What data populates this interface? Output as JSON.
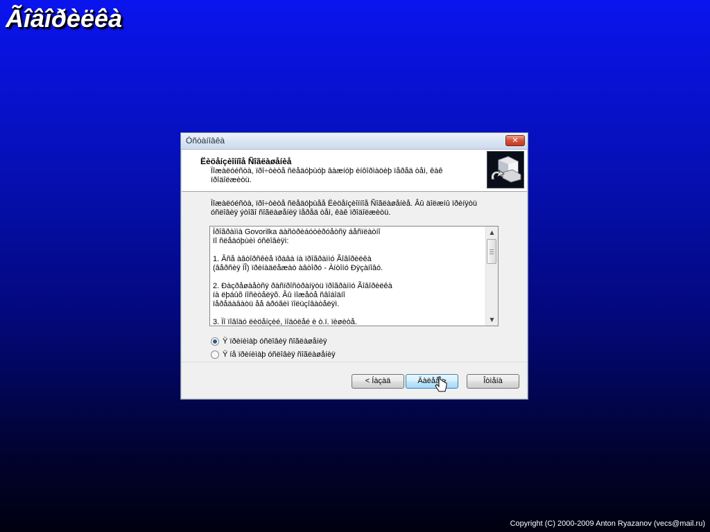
{
  "app": {
    "title": "Ãîâîðèëêà",
    "copyright": "Copyright (C) 2000-2009 Anton Ryazanov (vecs@mail.ru)"
  },
  "dialog": {
    "title": "Óñòàíîâêà",
    "close_label": "✕",
    "header": {
      "title": "Ëèöåíçèîííîå Ñîãëàøåíèå",
      "subtitle": "Ïîæàëóéñòà, ïðî÷òèòå ñëåäóþùóþ âàæíóþ èíôîðìàöèþ ïåðåä òåì, êàê ïðîäîëæèòü."
    },
    "intro": "Ïîæàëóéñòà, ïðî÷òèòå ñëåäóþùåå Ëèöåíçèîííîå Ñîãëàøåíèå. Âû äîëæíû ïðèíÿòü óñëîâèÿ ýòîãî ñîãëàøåíèÿ ïåðåä òåì, êàê ïðîäîëæèòü.",
    "license_text": "Ïðîãðàììà Govorilka äàñòðèáóòèðóåòñÿ áåñïëàòíî\nïî ñëåäóþùèì óñëîâèÿì:\n\n   1. Âñå àâòîðñêèå ïðàâà íà ïðîãðàììó Ãîâîðèëêà\n   (âåðñèÿ ÏÎ) ïðèíàäëåæàò àâòîðó - Àíòîíó Ðÿçàíîâó.\n\n   2. Ðàçðåøàåòñÿ ðàñïðîñòðàíÿòü ïðîãðàììó Ãîâîðèëêà\n   íà ëþáûõ íîñèòåëÿõ. Âû ìîæåòå ñâîáîäíî\n   ïåðåäàâàòü åå äðóãèì ïîëüçîâàòåëÿì.\n\n   3. Ïî ïîâîäó ëèöåíçèé, ìîäóëåé è ò.ï. ïèøèòå."
  },
  "radios": {
    "accept": "Ÿ ïðèíèìàþ óñëîâèÿ ñîãëàøåíèÿ",
    "decline": "Ÿ íå ïðèíèìàþ óñëîâèÿ ñîãëàøåíèÿ",
    "selected": "accept"
  },
  "buttons": {
    "back": "< Íàçàä",
    "next": "Äàëåå >",
    "cancel": "Îòìåíà"
  }
}
